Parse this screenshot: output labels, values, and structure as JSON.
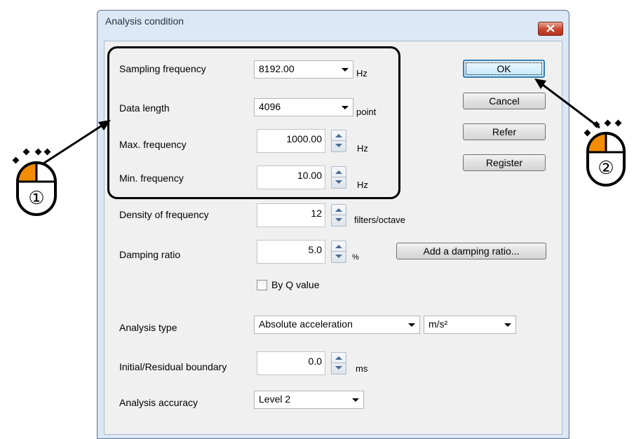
{
  "window": {
    "title": "Analysis condition"
  },
  "fields": {
    "sampling_frequency": {
      "label": "Sampling frequency",
      "value": "8192.00",
      "unit": "Hz"
    },
    "data_length": {
      "label": "Data length",
      "value": "4096",
      "unit": "point"
    },
    "max_frequency": {
      "label": "Max. frequency",
      "value": "1000.00",
      "unit": "Hz"
    },
    "min_frequency": {
      "label": "Min. frequency",
      "value": "10.00",
      "unit": "Hz"
    },
    "density_of_frequency": {
      "label": "Density of frequency",
      "value": "12",
      "unit": "filters/octave"
    },
    "damping_ratio": {
      "label": "Damping ratio",
      "value": "5.0",
      "unit": "%"
    },
    "by_q_value": {
      "label": "By Q value",
      "checked": false
    },
    "analysis_type": {
      "label": "Analysis type",
      "value": "Absolute acceleration",
      "unit_value": "m/s²"
    },
    "initial_residual_boundary": {
      "label": "Initial/Residual boundary",
      "value": "0.0",
      "unit": "ms"
    },
    "analysis_accuracy": {
      "label": "Analysis accuracy",
      "value": "Level 2"
    }
  },
  "buttons": {
    "ok": "OK",
    "cancel": "Cancel",
    "refer": "Refer",
    "register": "Register",
    "add_damping_ratio": "Add a damping ratio..."
  },
  "callouts": {
    "one": "①",
    "two": "②"
  },
  "colors": {
    "accent": "#f28c00",
    "title_bar": "#dce8f5",
    "close_button": "#c8452d"
  }
}
